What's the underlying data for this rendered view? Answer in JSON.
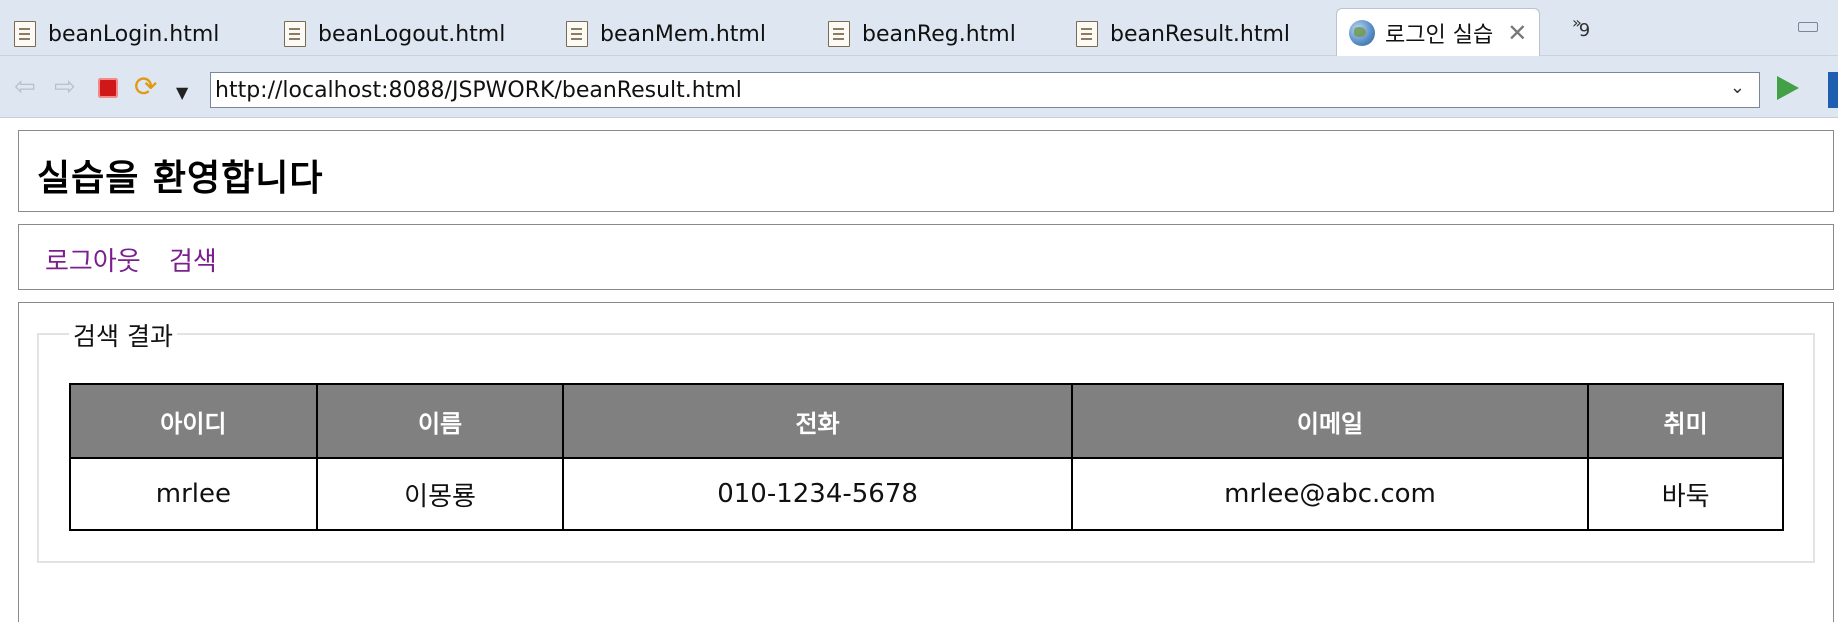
{
  "tabs": [
    {
      "label": "beanLogin.html",
      "icon": "html-file-icon"
    },
    {
      "label": "beanLogout.html",
      "icon": "html-file-icon"
    },
    {
      "label": "beanMem.html",
      "icon": "html-file-icon"
    },
    {
      "label": "beanReg.html",
      "icon": "html-file-icon"
    },
    {
      "label": "beanResult.html",
      "icon": "html-file-icon"
    },
    {
      "label": "로그인 실습",
      "icon": "globe-icon",
      "active": true
    }
  ],
  "overflow_count": "9",
  "toolbar": {
    "url": "http://localhost:8088/JSPWORK/beanResult.html"
  },
  "page": {
    "title": "실습을 환영합니다",
    "nav": [
      "로그아웃",
      "검색"
    ],
    "legend": "검색 결과",
    "table": {
      "headers": [
        "아이디",
        "이름",
        "전화",
        "이메일",
        "취미"
      ],
      "rows": [
        [
          "mrlee",
          "이몽룡",
          "010-1234-5678",
          "mrlee@abc.com",
          "바둑"
        ]
      ]
    }
  },
  "colors": {
    "link": "#7b1f8e",
    "table_header_bg": "#808080",
    "chrome_bg": "#dde6f1"
  }
}
